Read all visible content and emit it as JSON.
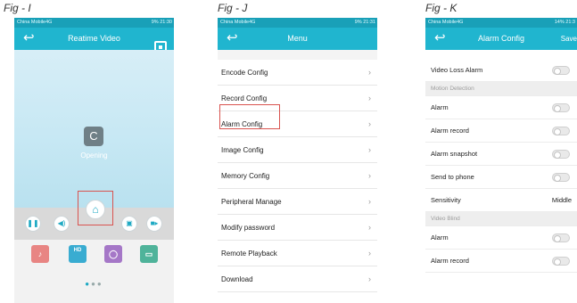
{
  "figures": {
    "fig_i": {
      "label": "Fig - I"
    },
    "fig_j": {
      "label": "Fig - J"
    },
    "fig_k": {
      "label": "Fig - K"
    }
  },
  "phone_i": {
    "status": {
      "carrier": "China Mobile4G",
      "right": "9%  21:30"
    },
    "title": "Reatime Video",
    "video": {
      "loading_text": "Opening"
    },
    "controls": [
      "pause-icon",
      "volume-icon",
      "home-icon",
      "snapshot-icon",
      "record-video-icon"
    ],
    "tools": [
      {
        "name": "microphone-icon",
        "glyph": "🎙"
      },
      {
        "name": "hd-icon",
        "label": "HD"
      },
      {
        "name": "record-icon",
        "glyph": "◯"
      },
      {
        "name": "camera-switch-icon",
        "glyph": "▭"
      }
    ]
  },
  "phone_j": {
    "status": {
      "carrier": "China Mobile4G",
      "right": "9%  21:31"
    },
    "title": "Menu",
    "items": [
      "Encode Config",
      "Record Config",
      "Alarm Config",
      "Image Config",
      "Memory Config",
      "Peripheral Manage",
      "Modify password",
      "Remote Playback",
      "Download"
    ]
  },
  "phone_k": {
    "status": {
      "carrier": "China Mobile4G",
      "right": "14%  21:3"
    },
    "title": "Alarm Config",
    "save": "Save",
    "rows": [
      {
        "type": "toggle",
        "label": "Video Loss Alarm"
      },
      {
        "type": "section",
        "label": "Motion Detection"
      },
      {
        "type": "toggle",
        "label": "Alarm"
      },
      {
        "type": "toggle",
        "label": "Alarm record"
      },
      {
        "type": "toggle",
        "label": "Alarm snapshot"
      },
      {
        "type": "toggle",
        "label": "Send to phone"
      },
      {
        "type": "select",
        "label": "Sensitivity",
        "value": "Middle"
      },
      {
        "type": "section",
        "label": "Video Blind"
      },
      {
        "type": "toggle",
        "label": "Alarm"
      },
      {
        "type": "toggle",
        "label": "Alarm record"
      }
    ]
  },
  "colors": {
    "accent": "#20b5cf",
    "highlight": "#d9534f"
  }
}
